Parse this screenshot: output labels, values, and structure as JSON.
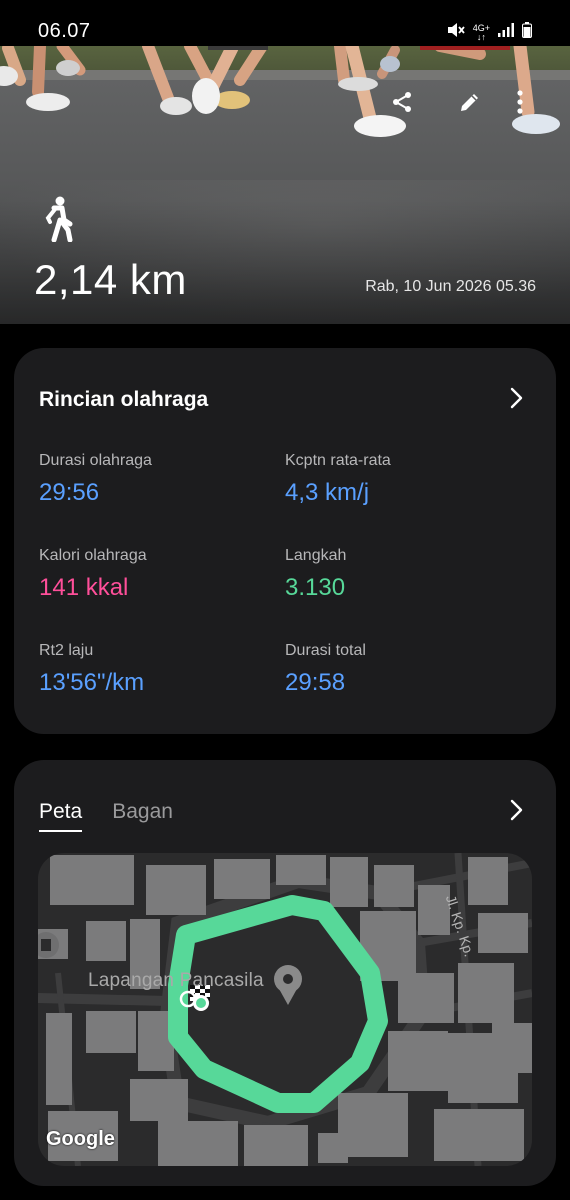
{
  "status_bar": {
    "time": "06.07",
    "network": "4G+",
    "icons": [
      "mute-icon",
      "network-4g-icon",
      "signal-icon",
      "battery-icon"
    ]
  },
  "hero": {
    "distance": "2,14 km",
    "datetime": "Rab, 10 Jun 2026 05.36",
    "activity_icon": "walking-icon",
    "actions": [
      "share-icon",
      "edit-icon",
      "more-icon"
    ]
  },
  "details": {
    "title": "Rincian olahraga",
    "stats": [
      {
        "label": "Durasi olahraga",
        "value": "29:56",
        "color": "#5aa0ff"
      },
      {
        "label": "Kcptn rata-rata",
        "value": "4,3 km/j",
        "color": "#5aa0ff"
      },
      {
        "label": "Kalori olahraga",
        "value": "141 kkal",
        "color": "#ff4f9a"
      },
      {
        "label": "Langkah",
        "value": "3.130",
        "color": "#57d899"
      },
      {
        "label": "Rt2 laju",
        "value": "13'56\"/km",
        "color": "#5aa0ff"
      },
      {
        "label": "Durasi total",
        "value": "29:58",
        "color": "#5aa0ff"
      }
    ]
  },
  "map_card": {
    "tabs": [
      "Peta",
      "Bagan"
    ],
    "active_tab": "Peta",
    "place_label": "Lapangan Pancasila",
    "street_label": "Jl. Kp. Kp.",
    "attribution": "Google",
    "route_color": "#57d899"
  }
}
